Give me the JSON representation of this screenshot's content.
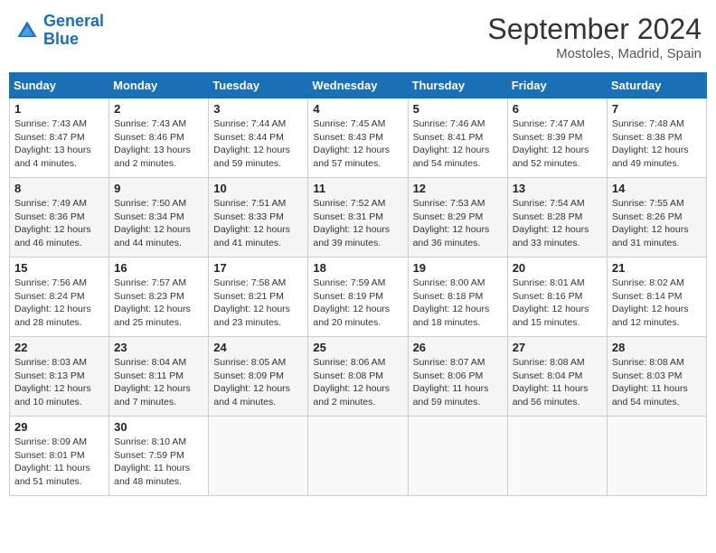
{
  "header": {
    "logo_line1": "General",
    "logo_line2": "Blue",
    "month": "September 2024",
    "location": "Mostoles, Madrid, Spain"
  },
  "days_of_week": [
    "Sunday",
    "Monday",
    "Tuesday",
    "Wednesday",
    "Thursday",
    "Friday",
    "Saturday"
  ],
  "weeks": [
    [
      {
        "day": 1,
        "sunrise": "7:43 AM",
        "sunset": "8:47 PM",
        "daylight": "Daylight: 13 hours and 4 minutes."
      },
      {
        "day": 2,
        "sunrise": "7:43 AM",
        "sunset": "8:46 PM",
        "daylight": "Daylight: 13 hours and 2 minutes."
      },
      {
        "day": 3,
        "sunrise": "7:44 AM",
        "sunset": "8:44 PM",
        "daylight": "Daylight: 12 hours and 59 minutes."
      },
      {
        "day": 4,
        "sunrise": "7:45 AM",
        "sunset": "8:43 PM",
        "daylight": "Daylight: 12 hours and 57 minutes."
      },
      {
        "day": 5,
        "sunrise": "7:46 AM",
        "sunset": "8:41 PM",
        "daylight": "Daylight: 12 hours and 54 minutes."
      },
      {
        "day": 6,
        "sunrise": "7:47 AM",
        "sunset": "8:39 PM",
        "daylight": "Daylight: 12 hours and 52 minutes."
      },
      {
        "day": 7,
        "sunrise": "7:48 AM",
        "sunset": "8:38 PM",
        "daylight": "Daylight: 12 hours and 49 minutes."
      }
    ],
    [
      {
        "day": 8,
        "sunrise": "7:49 AM",
        "sunset": "8:36 PM",
        "daylight": "Daylight: 12 hours and 46 minutes."
      },
      {
        "day": 9,
        "sunrise": "7:50 AM",
        "sunset": "8:34 PM",
        "daylight": "Daylight: 12 hours and 44 minutes."
      },
      {
        "day": 10,
        "sunrise": "7:51 AM",
        "sunset": "8:33 PM",
        "daylight": "Daylight: 12 hours and 41 minutes."
      },
      {
        "day": 11,
        "sunrise": "7:52 AM",
        "sunset": "8:31 PM",
        "daylight": "Daylight: 12 hours and 39 minutes."
      },
      {
        "day": 12,
        "sunrise": "7:53 AM",
        "sunset": "8:29 PM",
        "daylight": "Daylight: 12 hours and 36 minutes."
      },
      {
        "day": 13,
        "sunrise": "7:54 AM",
        "sunset": "8:28 PM",
        "daylight": "Daylight: 12 hours and 33 minutes."
      },
      {
        "day": 14,
        "sunrise": "7:55 AM",
        "sunset": "8:26 PM",
        "daylight": "Daylight: 12 hours and 31 minutes."
      }
    ],
    [
      {
        "day": 15,
        "sunrise": "7:56 AM",
        "sunset": "8:24 PM",
        "daylight": "Daylight: 12 hours and 28 minutes."
      },
      {
        "day": 16,
        "sunrise": "7:57 AM",
        "sunset": "8:23 PM",
        "daylight": "Daylight: 12 hours and 25 minutes."
      },
      {
        "day": 17,
        "sunrise": "7:58 AM",
        "sunset": "8:21 PM",
        "daylight": "Daylight: 12 hours and 23 minutes."
      },
      {
        "day": 18,
        "sunrise": "7:59 AM",
        "sunset": "8:19 PM",
        "daylight": "Daylight: 12 hours and 20 minutes."
      },
      {
        "day": 19,
        "sunrise": "8:00 AM",
        "sunset": "8:18 PM",
        "daylight": "Daylight: 12 hours and 18 minutes."
      },
      {
        "day": 20,
        "sunrise": "8:01 AM",
        "sunset": "8:16 PM",
        "daylight": "Daylight: 12 hours and 15 minutes."
      },
      {
        "day": 21,
        "sunrise": "8:02 AM",
        "sunset": "8:14 PM",
        "daylight": "Daylight: 12 hours and 12 minutes."
      }
    ],
    [
      {
        "day": 22,
        "sunrise": "8:03 AM",
        "sunset": "8:13 PM",
        "daylight": "Daylight: 12 hours and 10 minutes."
      },
      {
        "day": 23,
        "sunrise": "8:04 AM",
        "sunset": "8:11 PM",
        "daylight": "Daylight: 12 hours and 7 minutes."
      },
      {
        "day": 24,
        "sunrise": "8:05 AM",
        "sunset": "8:09 PM",
        "daylight": "Daylight: 12 hours and 4 minutes."
      },
      {
        "day": 25,
        "sunrise": "8:06 AM",
        "sunset": "8:08 PM",
        "daylight": "Daylight: 12 hours and 2 minutes."
      },
      {
        "day": 26,
        "sunrise": "8:07 AM",
        "sunset": "8:06 PM",
        "daylight": "Daylight: 11 hours and 59 minutes."
      },
      {
        "day": 27,
        "sunrise": "8:08 AM",
        "sunset": "8:04 PM",
        "daylight": "Daylight: 11 hours and 56 minutes."
      },
      {
        "day": 28,
        "sunrise": "8:08 AM",
        "sunset": "8:03 PM",
        "daylight": "Daylight: 11 hours and 54 minutes."
      }
    ],
    [
      {
        "day": 29,
        "sunrise": "8:09 AM",
        "sunset": "8:01 PM",
        "daylight": "Daylight: 11 hours and 51 minutes."
      },
      {
        "day": 30,
        "sunrise": "8:10 AM",
        "sunset": "7:59 PM",
        "daylight": "Daylight: 11 hours and 48 minutes."
      },
      null,
      null,
      null,
      null,
      null
    ]
  ]
}
